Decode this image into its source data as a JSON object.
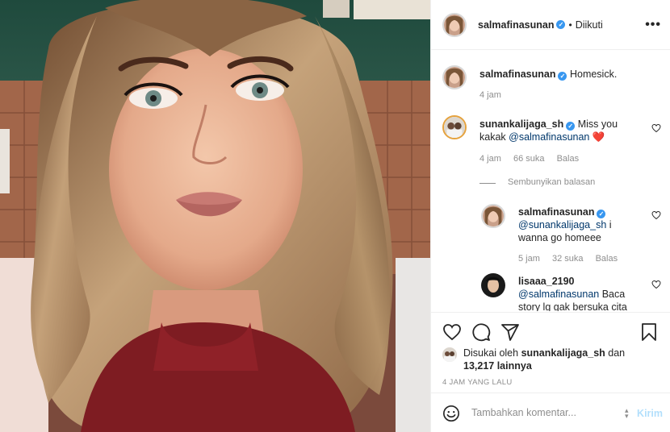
{
  "post": {
    "author": "salmafinasunan",
    "follow_separator": "•",
    "follow_status": "Diikuti",
    "more_icon": "more-horizontal-icon"
  },
  "caption": {
    "username": "salmafinasunan",
    "text": "Homesick.",
    "time": "4 jam"
  },
  "comments": [
    {
      "username": "sunankalijaga_sh",
      "text_prefix": "Miss you",
      "text_line2_prefix": "kakak ",
      "mention": "@salmafinasunan",
      "text_suffix": " ❤️",
      "time": "4 jam",
      "likes": "66 suka",
      "reply": "Balas"
    }
  ],
  "hide_replies": "Sembunyikan balasan",
  "replies": [
    {
      "username": "salmafinasunan",
      "mention": "@sunankalijaga_sh",
      "text_a": " i",
      "text_b": "wanna go homeee",
      "time": "5 jam",
      "likes": "32 suka",
      "reply": "Balas"
    },
    {
      "username": "lisaaa_2190",
      "mention": "@salmafinasunan",
      "text_a": " Baca",
      "text_b": "story lg gak bersuka cita"
    }
  ],
  "likes": {
    "prefix": "Disukai oleh ",
    "user": "sunankalijaga_sh",
    "mid": " dan",
    "count": "13,217 lainnya"
  },
  "timestamp": "4 JAM YANG LALU",
  "add_comment": {
    "placeholder": "Tambahkan komentar...",
    "send": "Kirim"
  },
  "colors": {
    "link": "#00376b",
    "verified": "#3897f0",
    "muted": "#8e8e8e",
    "send_disabled": "#b2dffc"
  }
}
